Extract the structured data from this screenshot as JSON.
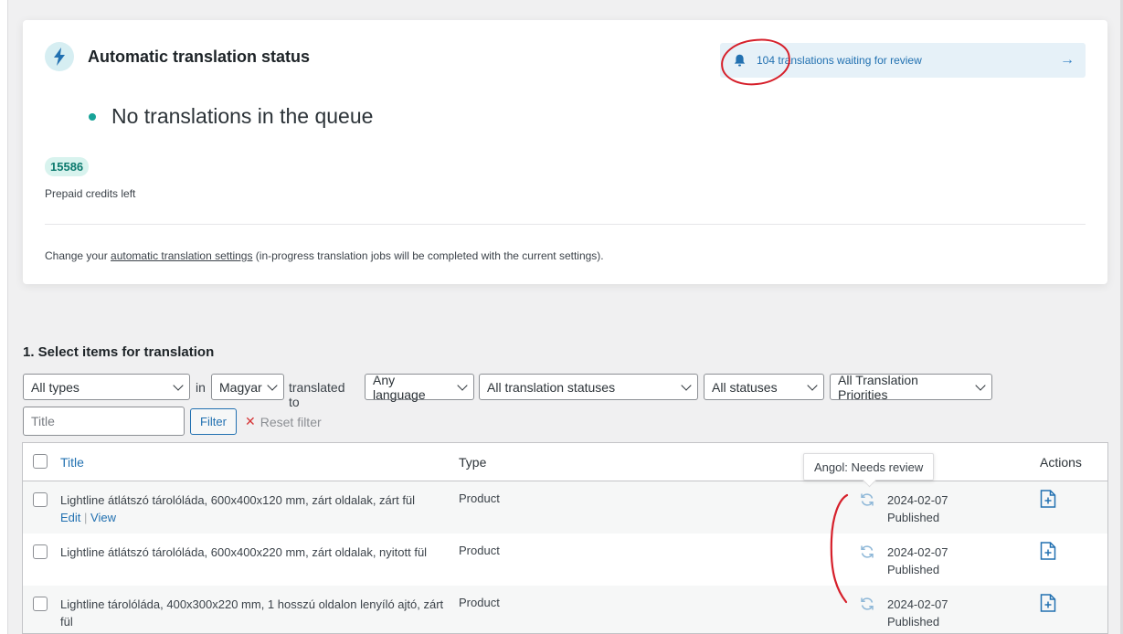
{
  "status_card": {
    "title": "Automatic translation status",
    "queue_status": "No translations in the queue",
    "credits_value": "15586",
    "credits_label": "Prepaid credits left",
    "settings_prefix": "Change your ",
    "settings_link": "automatic translation settings",
    "settings_suffix": " (in-progress translation jobs will be completed with the current settings).",
    "review_banner": "104 translations waiting for review"
  },
  "section": {
    "heading": "1. Select items for translation"
  },
  "filters": {
    "type": "All types",
    "in_label": "in",
    "source_language": "Magyar",
    "translated_to_label": "translated to",
    "target_language": "Any language",
    "translation_status": "All translation statuses",
    "post_status": "All statuses",
    "priority": "All Translation Priorities",
    "title_placeholder": "Title",
    "filter_button": "Filter",
    "reset_filter": "Reset filter"
  },
  "table": {
    "columns": {
      "title": "Title",
      "type": "Type",
      "actions": "Actions"
    },
    "tooltip": "Angol: Needs review",
    "rows": [
      {
        "title": "Lightline átlátszó tárolóláda, 600x400x120 mm, zárt oldalak, zárt fül",
        "edit": "Edit",
        "separator": "|",
        "view": "View",
        "type": "Product",
        "date": "2024-02-07",
        "status": "Published"
      },
      {
        "title": "Lightline átlátszó tárolóláda, 600x400x220 mm, zárt oldalak, nyitott fül",
        "type": "Product",
        "date": "2024-02-07",
        "status": "Published"
      },
      {
        "title": "Lightline tárolóláda, 400x300x220 mm, 1 hosszú oldalon lenyíló ajtó, zárt fül",
        "type": "Product",
        "date": "2024-02-07",
        "status": "Published"
      }
    ]
  },
  "colors": {
    "accent": "#2271b1",
    "success": "#17a398",
    "annotation": "#d6202b"
  },
  "icons": {
    "status": "bolt-icon",
    "banner": "bell-icon",
    "banner_arrow": "arrow-right-icon",
    "row_status": "refresh-icon",
    "row_action": "add-document-icon"
  }
}
